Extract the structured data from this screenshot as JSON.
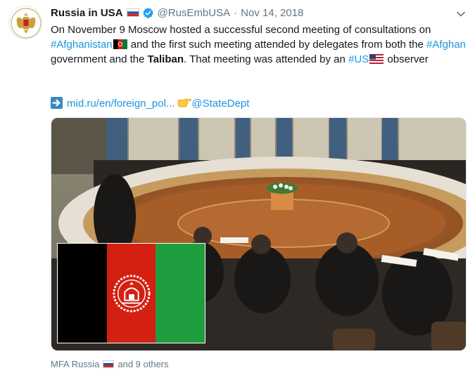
{
  "tweet": {
    "display_name": "Russia in USA",
    "handle": "@RusEmbUSA",
    "separator": "·",
    "date": "Nov 14, 2018",
    "body": {
      "t1": "On November 9 Moscow hosted a successful second meeting of consultations on ",
      "tag1": "#Afghanistan",
      "t2": " and the first such meeting attended by delegates from both the ",
      "tag2": "#Afghan",
      "t3": " government and the ",
      "bold1": "Taliban",
      "t4": ". That meeting was attended by an ",
      "tag3": "#US",
      "t5": " observer"
    },
    "link_text": "mid.ru/en/foreign_pol...",
    "mention": "@StateDept",
    "footer": {
      "label": "MFA Russia",
      "suffix": "and 9 others"
    }
  },
  "icons": {
    "avatar": "russian-emblem-icon",
    "verified": "verified-badge-icon",
    "caret": "chevron-down-icon",
    "link_arrow": "right-arrow-icon",
    "pointer": "pointing-hand-icon"
  },
  "colors": {
    "link": "#1b95e0",
    "secondary": "#657786",
    "verified": "#1da1f2"
  }
}
